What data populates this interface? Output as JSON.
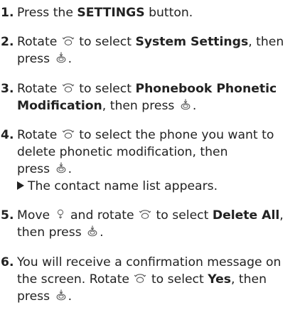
{
  "steps": [
    {
      "number": "1.",
      "p1": "Press the ",
      "b1": "SETTINGS",
      "p2": " button."
    },
    {
      "number": "2.",
      "p1": "Rotate",
      "p2": " to select ",
      "b1": "System Settings",
      "p3": ", then",
      "p4": "press",
      "p5": "."
    },
    {
      "number": "3.",
      "p1": "Rotate",
      "p2": " to select ",
      "b1": "Phonebook Phonetic",
      "b2": "Modification",
      "p3": ", then press",
      "p4": "."
    },
    {
      "number": "4.",
      "p1": "Rotate",
      "p2": " to select the phone you want to",
      "line2": "delete phonetic modification, then",
      "p3": "press",
      "p4": ".",
      "result": "The contact name list appears."
    },
    {
      "number": "5.",
      "p1": "Move",
      "p2": " and rotate",
      "p3": " to select ",
      "b1": "Delete All",
      "p4": ",",
      "p5": "then press",
      "p6": "."
    },
    {
      "number": "6.",
      "line1": "You will receive a confirmation message on",
      "p1": "the screen. Rotate",
      "p2": " to select ",
      "b1": "Yes",
      "p3": ", then",
      "p4": "press",
      "p5": "."
    }
  ],
  "icons": {
    "rotate": "rotate-dial-icon",
    "press": "press-dial-icon",
    "move": "move-dial-icon"
  }
}
